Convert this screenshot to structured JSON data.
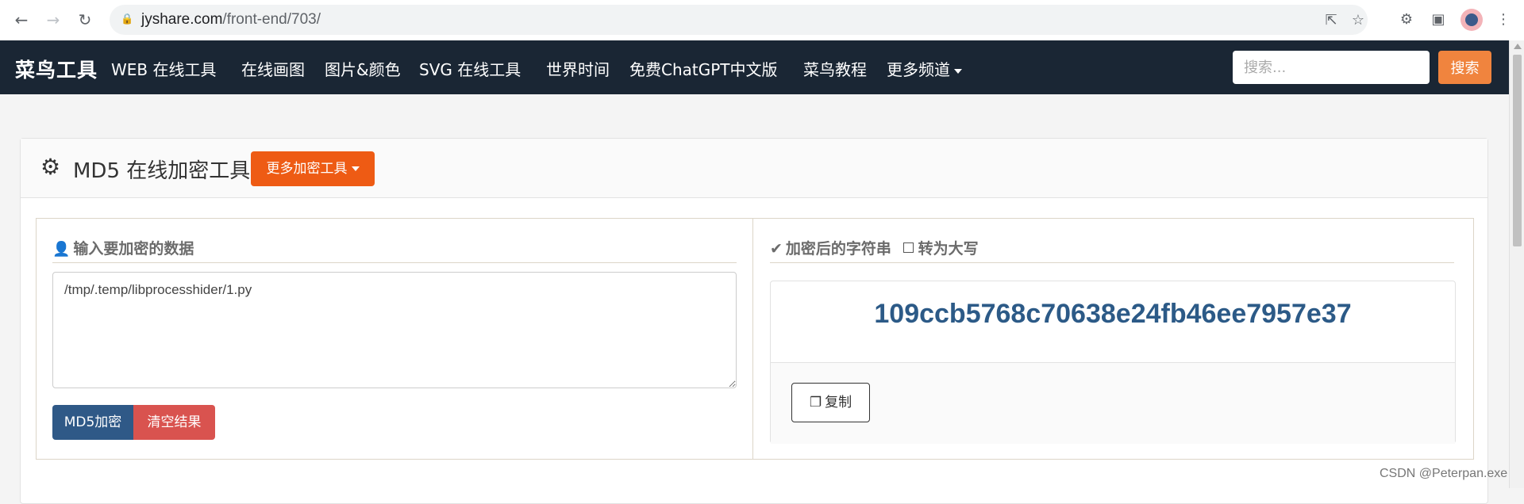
{
  "browser": {
    "url_host": "jyshare.com",
    "url_path": "/front-end/703/"
  },
  "site": {
    "brand": "菜鸟工具",
    "nav": [
      {
        "label": "WEB 在线工具"
      },
      {
        "label": "在线画图"
      },
      {
        "label": "图片&颜色"
      },
      {
        "label": "SVG 在线工具"
      },
      {
        "label": "世界时间"
      },
      {
        "label": "免费ChatGPT中文版"
      },
      {
        "label": "菜鸟教程"
      },
      {
        "label": "更多频道"
      }
    ],
    "search_placeholder": "搜索...",
    "search_button": "搜索"
  },
  "panel": {
    "title": "MD5 在线加密工具",
    "more_tools": "更多加密工具",
    "input_title": "输入要加密的数据",
    "input_value": "/tmp/.temp/libprocesshider/1.py",
    "md5_button": "MD5加密",
    "clear_button": "清空结果",
    "result_title": "加密后的字符串",
    "uppercase_label": "转为大写",
    "result_hash": "109ccb5768c70638e24fb46ee7957e37",
    "copy_button": "复制"
  },
  "watermark": "CSDN @Peterpan.exe"
}
